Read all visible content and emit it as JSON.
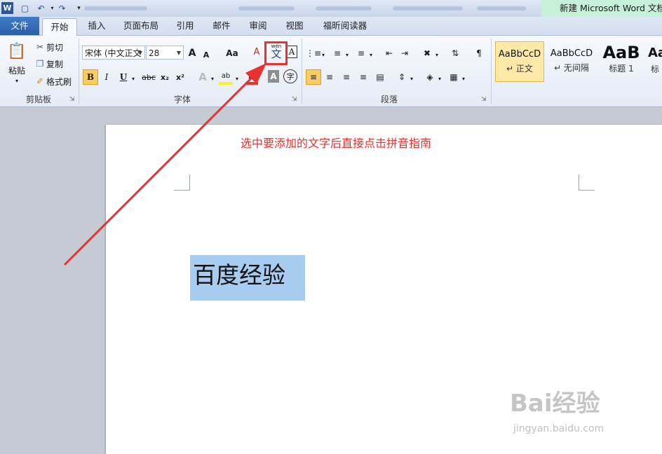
{
  "titlebar": {
    "app_icon": "W",
    "save_icon": "save-icon",
    "undo_icon": "undo-icon",
    "redo_icon": "redo-icon",
    "title": "新建 Microsoft Word 文档"
  },
  "tabs": [
    "文件",
    "开始",
    "插入",
    "页面布局",
    "引用",
    "邮件",
    "审阅",
    "视图",
    "福昕阅读器"
  ],
  "clipboard": {
    "paste": "粘贴",
    "cut": "剪切",
    "copy": "复制",
    "format_painter": "格式刷",
    "group_label": "剪贴板"
  },
  "font": {
    "font_name": "宋体 (中文正文",
    "font_size": "28",
    "grow": "A",
    "shrink": "A",
    "change_case": "Aa",
    "clear_format": "A",
    "phonetic_top": "wén",
    "phonetic_char": "文",
    "char_border": "A",
    "bold": "B",
    "italic": "I",
    "underline": "U",
    "strike": "abc",
    "subscript": "x₂",
    "superscript": "x²",
    "text_effect": "A",
    "highlight": "ab",
    "font_color": "A",
    "char_shading": "A",
    "enclose": "字",
    "group_label": "字体"
  },
  "paragraph": {
    "group_label": "段落"
  },
  "styles": [
    {
      "sample": "AaBbCcD",
      "name": "↵ 正文"
    },
    {
      "sample": "AaBbCcD",
      "name": "↵ 无间隔"
    },
    {
      "sample": "AaB",
      "name": "标题 1"
    },
    {
      "sample": "Aa",
      "name": "标"
    }
  ],
  "document": {
    "instruction": "选中要添加的文字后直接点击拼音指南",
    "selected_text": "百度经验"
  },
  "watermark": {
    "brand": "Bai经验",
    "url": "jingyan.baidu.com"
  },
  "colors": {
    "accent_red": "#e8322f",
    "selection": "#a8ccf0",
    "file_tab": "#2a5ea8"
  }
}
